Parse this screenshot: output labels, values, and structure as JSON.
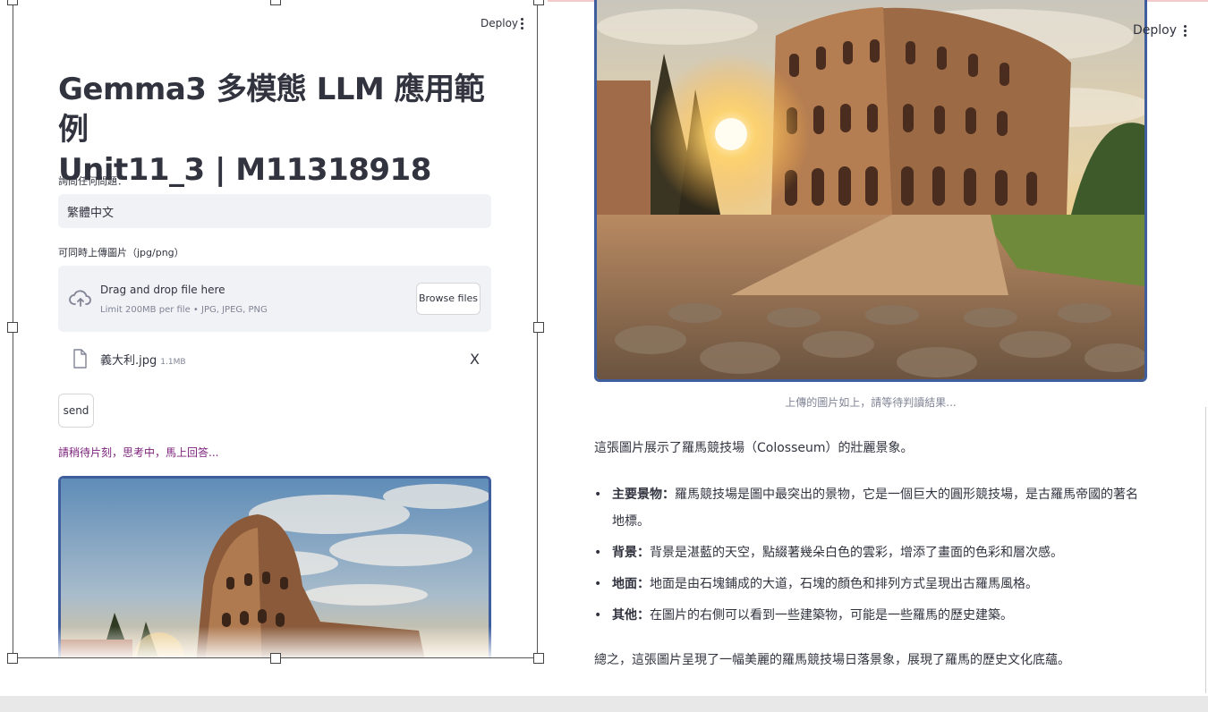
{
  "left": {
    "deploy_label": "Deploy",
    "title_line1": "Gemma3 多模態 LLM 應用範例",
    "title_line2": "Unit11_3 | M11318918",
    "question_label": "詢問任何問題：",
    "question_value": "繁體中文",
    "upload_label": "可同時上傳圖片（jpg/png）",
    "dropzone": {
      "main_text": "Drag and drop file here",
      "sub_text": "Limit 200MB per file • JPG, JPEG, PNG",
      "browse_label": "Browse files",
      "icon": "upload-cloud-icon"
    },
    "file": {
      "name": "義大利.jpg",
      "size": "1.1MB",
      "remove_label": "X",
      "icon": "file-icon"
    },
    "send_label": "send",
    "waiting_text": "請稍待片刻，思考中，馬上回答...",
    "waiting_color": "#7a1f7a"
  },
  "right": {
    "deploy_label": "Deploy",
    "caption": "上傳的圖片如上，請等待判讀結果...",
    "intro": "這張圖片展示了羅馬競技場（Colosseum）的壯麗景象。",
    "bullets": [
      {
        "term": "主要景物：",
        "text": "羅馬競技場是圖中最突出的景物，它是一個巨大的圓形競技場，是古羅馬帝國的著名地標。"
      },
      {
        "term": "背景：",
        "text": "背景是湛藍的天空，點綴著幾朵白色的雲彩，增添了畫面的色彩和層次感。"
      },
      {
        "term": "地面：",
        "text": "地面是由石塊鋪成的大道，石塊的顏色和排列方式呈現出古羅馬風格。"
      },
      {
        "term": "其他：",
        "text": "在圖片的右側可以看到一些建築物，可能是一些羅馬的歷史建築。"
      }
    ],
    "summary": "總之，這張圖片呈現了一幅美麗的羅馬競技場日落景象，展現了羅馬的歷史文化底蘊。"
  },
  "colors": {
    "image_border": "#3f5e9e",
    "input_bg": "#f0f2f6",
    "text": "#31333f"
  }
}
